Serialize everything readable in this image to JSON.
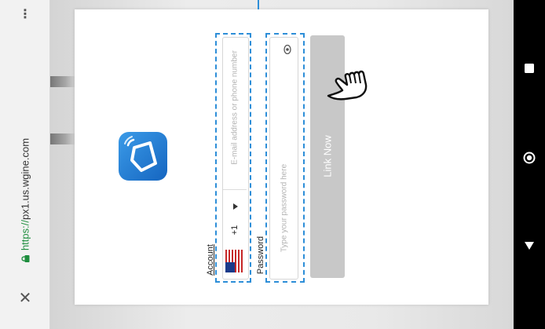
{
  "browser": {
    "url_scheme": "https://",
    "url_host": "px1.us.wgine.com",
    "menu_icon": "more-dots-icon",
    "close_icon": "close-icon",
    "lock_icon": "lock-icon"
  },
  "modal": {
    "app_icon": "smart-life-icon",
    "account_label": "Account",
    "country_code": "+1",
    "flag_icon": "us-flag-icon",
    "account_placeholder": "E-mail address or phone number",
    "password_label": "Password",
    "password_placeholder": "Type your password here",
    "show_password_icon": "eye-icon",
    "submit_label": "Link Now"
  },
  "overlay": {
    "pointer_icon": "tap-hand-icon",
    "highlight_color": "#2d8ed8"
  },
  "navbar": {
    "recents_icon": "square-icon",
    "home_icon": "circle-icon",
    "back_icon": "triangle-icon"
  },
  "colors": {
    "button_disabled": "#c8c8c8",
    "https_green": "#1e8e3e",
    "logo_blue": "#2f86e0"
  }
}
